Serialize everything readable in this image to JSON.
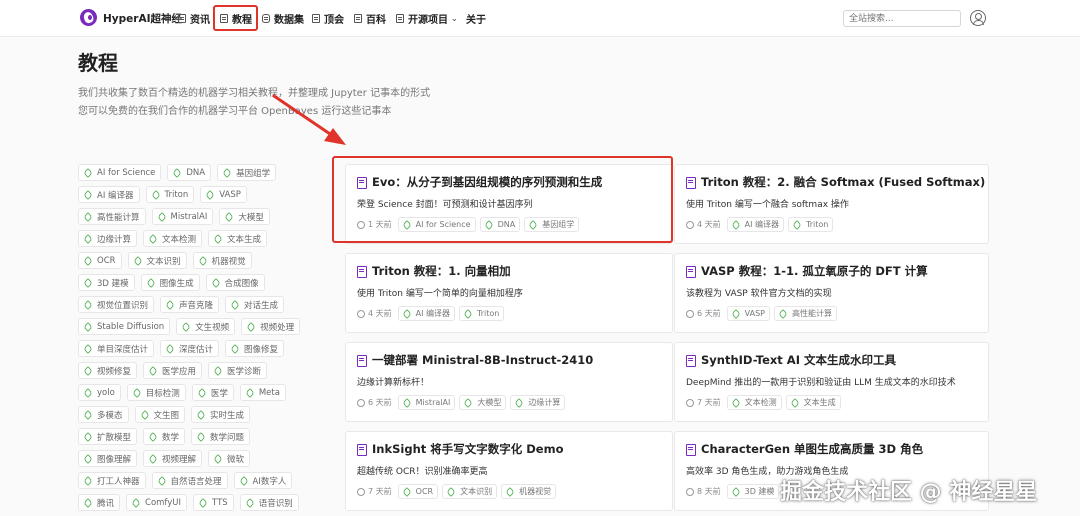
{
  "nav": {
    "brand": "HyperAI超神经",
    "items": [
      {
        "label": "资讯",
        "icon": "news-icon"
      },
      {
        "label": "教程",
        "icon": "book-icon",
        "active": true
      },
      {
        "label": "数据集",
        "icon": "database-icon"
      },
      {
        "label": "顶会",
        "icon": "conference-icon"
      },
      {
        "label": "百科",
        "icon": "encyclopedia-icon"
      },
      {
        "label": "开源项目",
        "icon": "code-icon",
        "dropdown": true
      },
      {
        "label": "关于",
        "icon": ""
      }
    ],
    "search_placeholder": "全站搜索..."
  },
  "page": {
    "title": "教程",
    "desc_line1": "我们共收集了数百个精选的机器学习相关教程，并整理成 Jupyter 记事本的形式",
    "desc_line2": "您可以免费的在我们合作的机器学习平台 OpenBayes 运行这些记事本"
  },
  "tags": [
    [
      "AI for Science",
      "DNA",
      "基因组学"
    ],
    [
      "AI 编译器",
      "Triton",
      "VASP"
    ],
    [
      "高性能计算",
      "MistralAI",
      "大模型"
    ],
    [
      "边缘计算",
      "文本检测",
      "文本生成"
    ],
    [
      "OCR",
      "文本识别",
      "机器视觉"
    ],
    [
      "3D 建模",
      "图像生成",
      "合成图像"
    ],
    [
      "视觉位置识别",
      "声音克隆",
      "对话生成"
    ],
    [
      "Stable Diffusion",
      "文生视频",
      "视频处理"
    ],
    [
      "单目深度估计",
      "深度估计",
      "图像修复"
    ],
    [
      "视频修复",
      "医学应用",
      "医学诊断"
    ],
    [
      "yolo",
      "目标检测",
      "医学",
      "Meta"
    ],
    [
      "多模态",
      "文生图",
      "实时生成"
    ],
    [
      "扩散模型",
      "数学",
      "数学问题"
    ],
    [
      "图像理解",
      "视频理解",
      "微软"
    ],
    [
      "打工人神器",
      "自然语言处理",
      "AI数字人"
    ],
    [
      "腾讯",
      "ComfyUI",
      "TTS",
      "语音识别"
    ]
  ],
  "cards": [
    {
      "title": "Evo：从分子到基因组规模的序列预测和生成",
      "desc": "荣登 Science 封面！可预测和设计基因序列",
      "time": "1 天前",
      "tags": [
        "AI for Science",
        "DNA",
        "基因组学"
      ]
    },
    {
      "title": "Triton 教程：2. 融合 Softmax (Fused Softmax)",
      "desc": "使用 Triton 编写一个融合 softmax 操作",
      "time": "4 天前",
      "tags": [
        "AI 编译器",
        "Triton"
      ]
    },
    {
      "title": "Triton 教程：1. 向量相加",
      "desc": "使用 Triton 编写一个简单的向量相加程序",
      "time": "4 天前",
      "tags": [
        "AI 编译器",
        "Triton"
      ]
    },
    {
      "title": "VASP 教程：1-1. 孤立氧原子的 DFT 计算",
      "desc": "该教程为 VASP 软件官方文档的实现",
      "time": "6 天前",
      "tags": [
        "VASP",
        "高性能计算"
      ]
    },
    {
      "title": "一键部署 Ministral-8B-Instruct-2410",
      "desc": "边缘计算新标杆！",
      "time": "6 天前",
      "tags": [
        "MistralAI",
        "大模型",
        "边缘计算"
      ]
    },
    {
      "title": "SynthID-Text AI 文本生成水印工具",
      "desc": "DeepMind 推出的一款用于识别和验证由 LLM 生成文本的水印技术",
      "time": "7 天前",
      "tags": [
        "文本检测",
        "文本生成"
      ]
    },
    {
      "title": "InkSight 将手写文字数字化 Demo",
      "desc": "超越传统 OCR！识别准确率更高",
      "time": "7 天前",
      "tags": [
        "OCR",
        "文本识别",
        "机器视觉"
      ]
    },
    {
      "title": "CharacterGen 单图生成高质量 3D 角色",
      "desc": "高效率 3D 角色生成，助力游戏角色生成",
      "time": "8 天前",
      "tags": [
        "3D 建模"
      ]
    }
  ],
  "watermark": "掘金技术社区 @ 神经星星",
  "colors": {
    "accent": "#7a2bbf",
    "highlight": "#e0332a",
    "tag_icon": "#4caf50"
  }
}
